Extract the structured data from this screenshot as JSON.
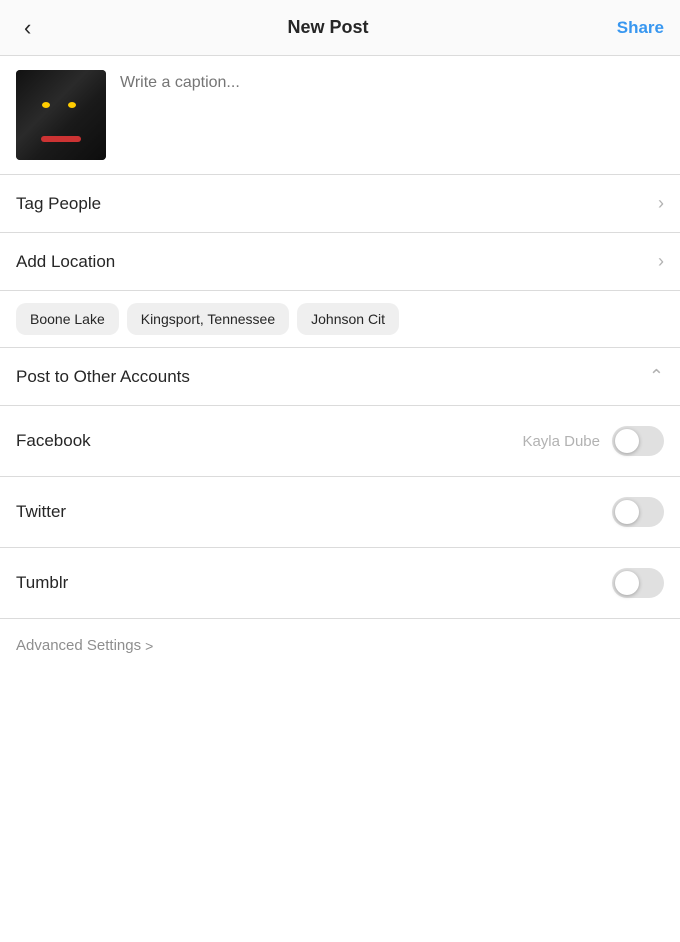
{
  "header": {
    "back_label": "<",
    "title": "New Post",
    "share_label": "Share"
  },
  "caption": {
    "placeholder": "Write a caption..."
  },
  "tag_people": {
    "label": "Tag People"
  },
  "add_location": {
    "label": "Add Location"
  },
  "location_chips": [
    {
      "label": "Boone Lake"
    },
    {
      "label": "Kingsport, Tennessee"
    },
    {
      "label": "Johnson Cit"
    }
  ],
  "post_to_other_accounts": {
    "label": "Post to Other Accounts"
  },
  "social_accounts": [
    {
      "platform": "Facebook",
      "username": "Kayla Dube",
      "enabled": false
    },
    {
      "platform": "Twitter",
      "username": "",
      "enabled": false
    },
    {
      "platform": "Tumblr",
      "username": "",
      "enabled": false
    }
  ],
  "advanced_settings": {
    "label": "Advanced Settings",
    "chevron": ">"
  }
}
